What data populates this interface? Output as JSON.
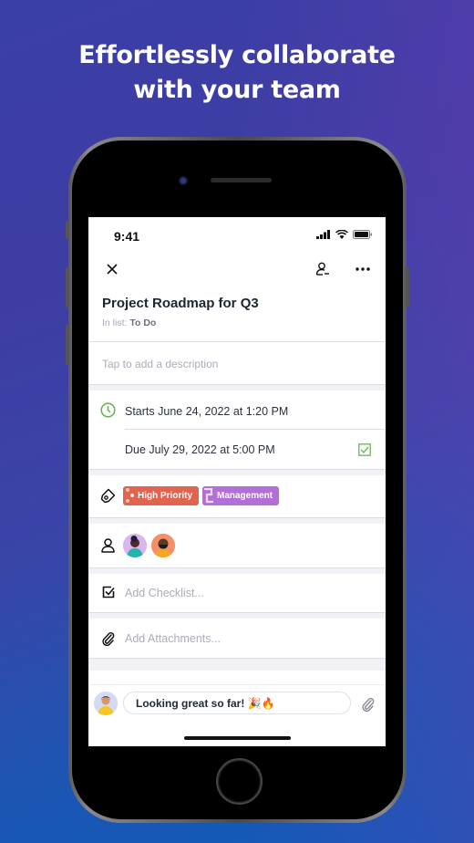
{
  "headline": {
    "line1": "Effortlessly collaborate",
    "line2": "with your team"
  },
  "status_bar": {
    "time": "9:41",
    "icons": [
      "signal-icon",
      "wifi-icon",
      "battery-icon"
    ]
  },
  "nav": {
    "close_icon": "close-icon",
    "assign_icon": "assign-user-icon",
    "more_icon": "more-icon"
  },
  "task": {
    "title": "Project Roadmap for Q3",
    "in_list_label": "In list:",
    "in_list_value": "To Do",
    "description_placeholder": "Tap to add a description"
  },
  "dates": {
    "start": "Starts June 24, 2022 at 1:20 PM",
    "due": "Due July 29, 2022 at 5:00 PM"
  },
  "tags": [
    {
      "label": "High Priority",
      "color": "#e06450"
    },
    {
      "label": "Management",
      "color": "#b36fd8"
    }
  ],
  "members": [
    {
      "name": "member-1",
      "bg": "#d9b6ec"
    },
    {
      "name": "member-2",
      "bg": "#f59a6a"
    }
  ],
  "checklist": {
    "placeholder": "Add Checklist..."
  },
  "attachments": {
    "placeholder": "Add Attachments..."
  },
  "comment": {
    "text": "Looking great so far! 🎉🔥"
  },
  "colors": {
    "accent_green": "#6ab457",
    "tag_high_priority": "#e06450",
    "tag_management": "#b36fd8"
  }
}
